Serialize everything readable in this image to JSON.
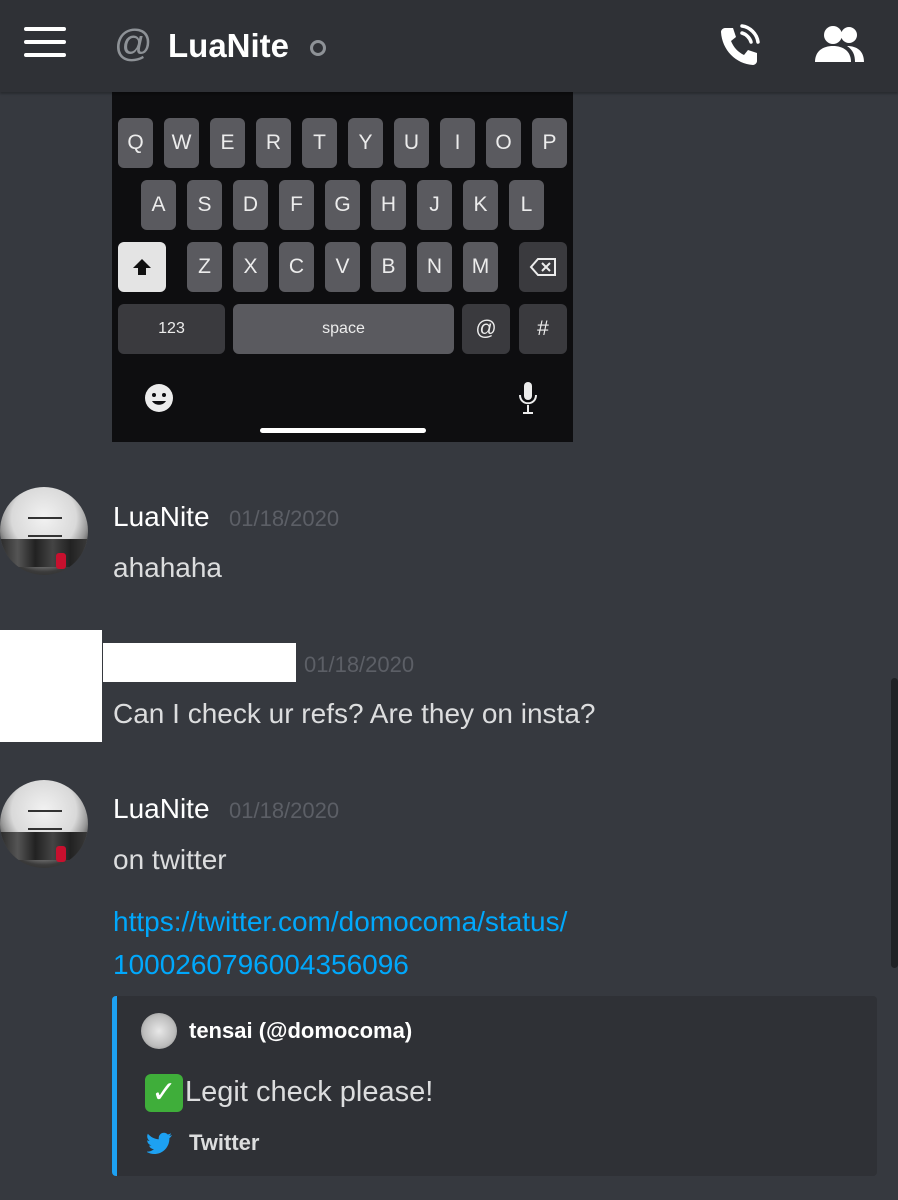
{
  "header": {
    "at_symbol": "@",
    "channel_name": "LuaNite",
    "icons": [
      "hamburger-menu-icon",
      "at-icon",
      "status-icon",
      "call-icon",
      "members-icon"
    ]
  },
  "keyboard_attachment": {
    "row1": [
      "Q",
      "W",
      "E",
      "R",
      "T",
      "Y",
      "U",
      "I",
      "O",
      "P"
    ],
    "row2": [
      "A",
      "S",
      "D",
      "F",
      "G",
      "H",
      "J",
      "K",
      "L"
    ],
    "row3": [
      "Z",
      "X",
      "C",
      "V",
      "B",
      "N",
      "M"
    ],
    "numbers_label": "123",
    "space_label": "space",
    "at_label": "@",
    "hash_label": "#",
    "icons": [
      "shift-icon",
      "backspace-icon",
      "emoji-icon",
      "microphone-icon"
    ]
  },
  "messages": [
    {
      "author": "LuaNite",
      "timestamp": "01/18/2020",
      "text": "ahahaha"
    },
    {
      "author": "",
      "timestamp": "01/18/2020",
      "text": "Can I check ur refs? Are they on insta?"
    },
    {
      "author": "LuaNite",
      "timestamp": "01/18/2020",
      "text": "on twitter",
      "link_line1": "https://twitter.com/domocoma/status/",
      "link_line2": "1000260796004356096"
    }
  ],
  "embed": {
    "author": "tensai (@domocoma)",
    "check_glyph": "✓",
    "description": "Legit check please!",
    "footer": "Twitter"
  },
  "colors": {
    "background": "#36393f",
    "header": "#2f3136",
    "link": "#00a8fc",
    "embed_border": "#1da1f2",
    "timestamp": "#5c5f66"
  }
}
